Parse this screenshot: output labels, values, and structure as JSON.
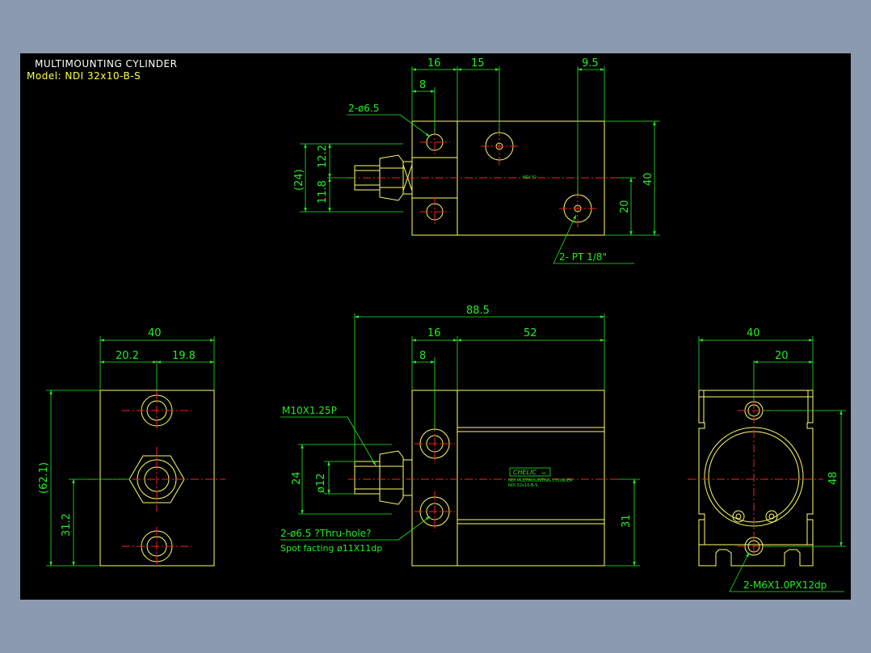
{
  "header": {
    "title": "MULTIMOUNTING CYLINDER",
    "model": "Model:  NDI 32x10-B-S"
  },
  "colors": {
    "background": "#8c9ab0",
    "canvas": "#000000",
    "outline": "#ffff66",
    "dimension": "#22ee22",
    "centerline": "#ff2020",
    "title_text": "#ffffff"
  },
  "top_view": {
    "dims": {
      "d16": "16",
      "d15": "15",
      "d9_5": "9.5",
      "d8": "8",
      "d12_2": "12.2",
      "d11_8": "11.8",
      "d24": "(24)",
      "d40": "40",
      "d20": "20"
    },
    "callouts": {
      "holes": "2-ø6.5",
      "ports": "2-  PT 1/8\""
    },
    "marking": "NDI 32"
  },
  "left_view": {
    "dims": {
      "d40": "40",
      "d20_2": "20.2",
      "d19_8": "19.8",
      "d62_1": "(62.1)",
      "d31_2": "31.2"
    }
  },
  "front_view": {
    "dims": {
      "d88_5": "88.5",
      "d16": "16",
      "d52": "52",
      "d8": "8",
      "d24": "24",
      "d12": "ø12",
      "d31": "31"
    },
    "callouts": {
      "thread": "M10X1.25P",
      "holes": "2-ø6.5 ?Thru-hole?",
      "spot": "Spot facting  ø11X11dp"
    },
    "label": {
      "brand": "CHELIC",
      "mark": "kk",
      "line1": "NDI MULTIMOUNTING CYLINDER",
      "line2": "NDI 32x10-B-S"
    }
  },
  "right_view": {
    "dims": {
      "d40": "40",
      "d20": "20",
      "d48": "48"
    },
    "callouts": {
      "taps": "2-M6X1.0PX12dp"
    }
  }
}
